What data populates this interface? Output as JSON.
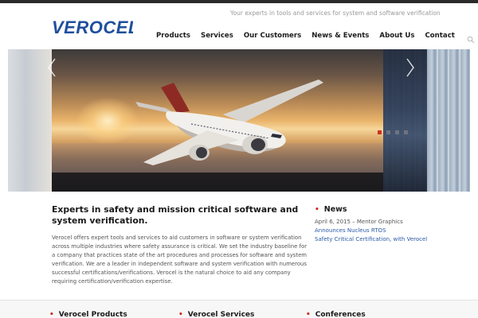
{
  "header": {
    "tagline": "Your experts in tools and services for system and software verification",
    "logo_text": "VEROCEL"
  },
  "nav": {
    "items": [
      {
        "label": "Products"
      },
      {
        "label": "Services"
      },
      {
        "label": "Our Customers"
      },
      {
        "label": "News & Events"
      },
      {
        "label": "About Us"
      },
      {
        "label": "Contact"
      }
    ],
    "search_icon": "search-icon"
  },
  "slider": {
    "total_slides": 4,
    "active_slide": 1
  },
  "main": {
    "title": "Experts in safety and mission critical software and system verification.",
    "body": "Verocel offers expert tools and services to aid customers in software or system verification across multiple industries where safety assurance is critical. We set the industry baseline for a company that practices state of the art procedures and processes for software and system verification. We are a leader in independent software and system verification with numerous successful certifications/verifications. Verocel is the natural choice to aid any company requiring certification/verification expertise."
  },
  "news": {
    "heading": "News",
    "date_line": "April 6, 2015 – Mentor Graphics",
    "link_line1": "Announces Nucleus RTOS",
    "link_line2": "Safety Critical Certification, with Verocel"
  },
  "footer": {
    "columns": [
      {
        "heading": "Verocel Products"
      },
      {
        "heading": "Verocel Services"
      },
      {
        "heading": "Conferences"
      }
    ]
  },
  "colors": {
    "accent_red": "#c8281a",
    "logo_blue": "#1f4f9e",
    "link_blue": "#2a5aa8"
  }
}
